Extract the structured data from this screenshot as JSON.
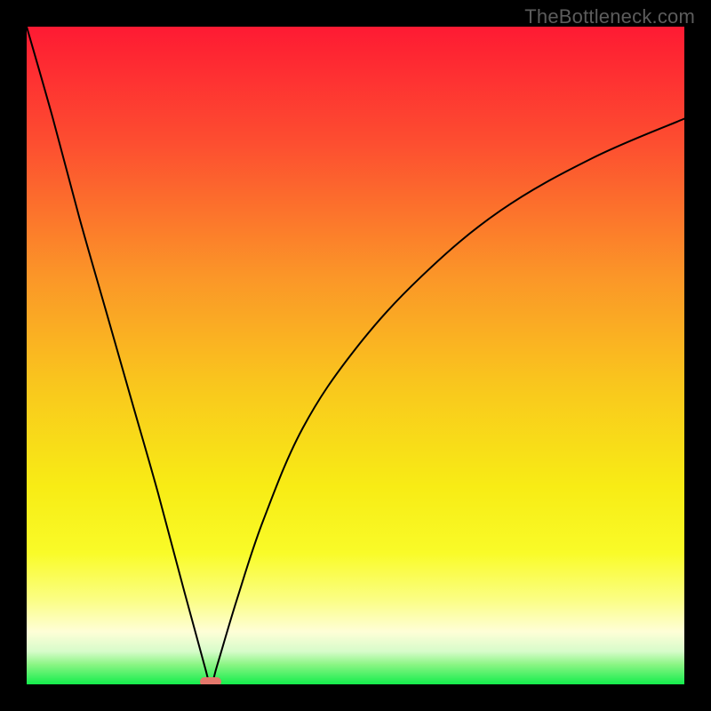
{
  "watermark": "TheBottleneck.com",
  "chart_data": {
    "type": "line",
    "title": "",
    "xlabel": "",
    "ylabel": "",
    "xlim": [
      0,
      100
    ],
    "ylim": [
      0,
      100
    ],
    "optimum_x": 28,
    "marker": {
      "x_pct": 28,
      "y_pct": 100,
      "color": "#e4776b"
    },
    "gradient_stops": [
      {
        "pct": 0,
        "color": "#fe1a33"
      },
      {
        "pct": 18,
        "color": "#fd4f30"
      },
      {
        "pct": 38,
        "color": "#fb9628"
      },
      {
        "pct": 55,
        "color": "#f9c81d"
      },
      {
        "pct": 70,
        "color": "#f8ec15"
      },
      {
        "pct": 80,
        "color": "#f9fb28"
      },
      {
        "pct": 87,
        "color": "#fbfe82"
      },
      {
        "pct": 92,
        "color": "#fefed7"
      },
      {
        "pct": 95,
        "color": "#d7fcca"
      },
      {
        "pct": 97,
        "color": "#8af584"
      },
      {
        "pct": 100,
        "color": "#14ed4c"
      }
    ],
    "series": [
      {
        "name": "bottleneck-curve",
        "x": [
          0,
          4,
          8,
          12,
          16,
          20,
          24,
          27,
          28,
          29,
          32,
          36,
          42,
          50,
          60,
          72,
          86,
          100
        ],
        "y": [
          100,
          86,
          71,
          57,
          43,
          29,
          14,
          3,
          0,
          3,
          13,
          25,
          39,
          51,
          62,
          72,
          80,
          86
        ]
      }
    ]
  }
}
